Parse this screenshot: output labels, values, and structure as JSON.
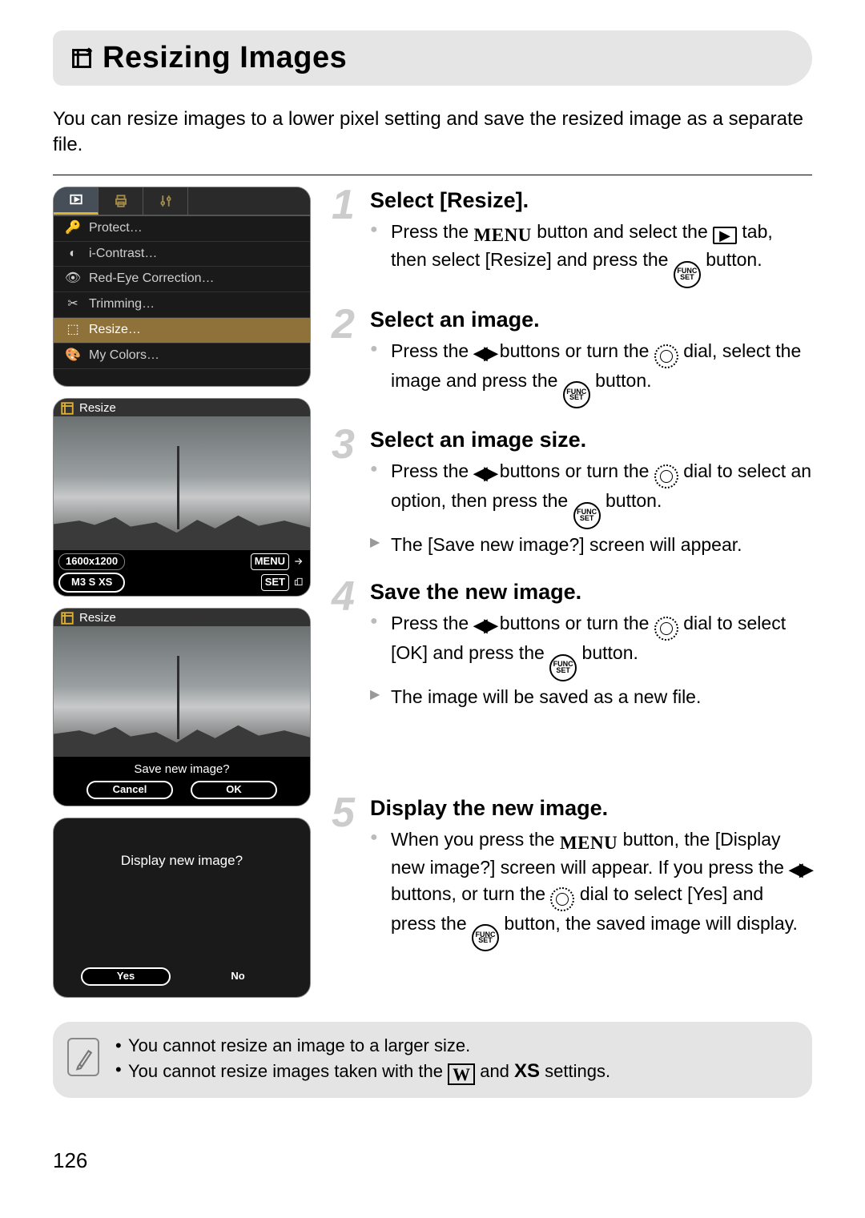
{
  "title": "Resizing Images",
  "intro": "You can resize images to a lower pixel setting and save the resized image as a separate file.",
  "pageNumber": "126",
  "cameraMenu": {
    "items": [
      {
        "label": "Protect…"
      },
      {
        "label": "i-Contrast…"
      },
      {
        "label": "Red-Eye Correction…"
      },
      {
        "label": "Trimming…"
      },
      {
        "label": "Resize…"
      },
      {
        "label": "My Colors…"
      }
    ]
  },
  "resizeShot": {
    "header": "Resize",
    "resolution": "1600x1200",
    "sizes": "M3 S XS",
    "menuLabel": "MENU",
    "setLabel": "SET"
  },
  "saveShot": {
    "header": "Resize",
    "prompt": "Save new image?",
    "cancel": "Cancel",
    "ok": "OK"
  },
  "displayPrompt": {
    "prompt": "Display new image?",
    "yes": "Yes",
    "no": "No"
  },
  "steps": [
    {
      "num": "1",
      "title": "Select [Resize].",
      "bullets": [
        {
          "type": "do",
          "html": "Press the {MENU} button and select the {PLAY} tab, then select [Resize] and press the {FUNC} button."
        }
      ]
    },
    {
      "num": "2",
      "title": "Select an image.",
      "bullets": [
        {
          "type": "do",
          "html": "Press the {LR} buttons or turn the {DIAL} dial, select the image and press the {FUNC} button."
        }
      ]
    },
    {
      "num": "3",
      "title": "Select an image size.",
      "bullets": [
        {
          "type": "do",
          "html": "Press the {LR} buttons or turn the {DIAL} dial to select an option, then press the {FUNC} button."
        },
        {
          "type": "result",
          "html": "The [Save new image?] screen will appear."
        }
      ]
    },
    {
      "num": "4",
      "title": "Save the new image.",
      "bullets": [
        {
          "type": "do",
          "html": "Press the {LR} buttons or turn the {DIAL} dial to select [OK] and press the {FUNC} button."
        },
        {
          "type": "result",
          "html": "The image will be saved as a new file."
        }
      ]
    },
    {
      "num": "5",
      "title": "Display the new image.",
      "bullets": [
        {
          "type": "do",
          "html": "When you press the {MENU} button, the [Display new image?] screen will appear. If you press the {LR} buttons, or turn the {DIAL} dial to select [Yes] and press the {FUNC} button, the saved image will display."
        }
      ]
    }
  ],
  "notes": [
    "You cannot resize an image to a larger size.",
    "You cannot resize images taken with the {W} and {XS} settings."
  ]
}
